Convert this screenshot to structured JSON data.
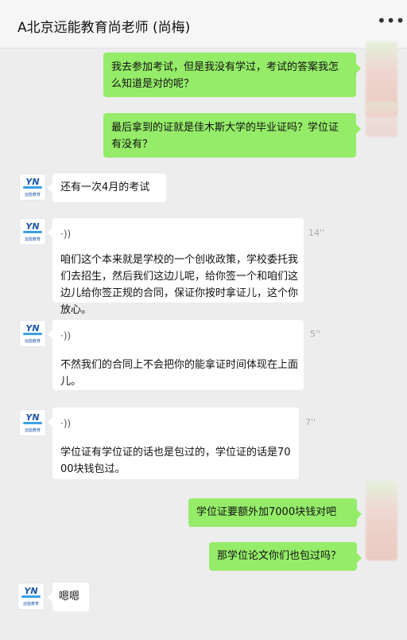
{
  "header": {
    "title": "A北京远能教育尚老师 (尚梅)",
    "more_icon": "more-dots-icon"
  },
  "avatar_other": {
    "logo_text": "YN",
    "logo_sub": "远能教育"
  },
  "messages": [
    {
      "from": "me",
      "text": "我去参加考试，但是我没有学过，考试的答案我怎么知道是对的呢？"
    },
    {
      "from": "me",
      "text": "最后拿到的证就是佳木斯大学的毕业证吗？学位证有没有？"
    },
    {
      "from": "other",
      "text": "还有一次4月的考试"
    },
    {
      "from": "other",
      "type": "voice",
      "duration": "14''",
      "voice_icon": "voice-wave-icon",
      "transcript": "咱们这个本来就是学校的一个创收政策，学校委托我们去招生，然后我们这边儿呢，给你签一个和咱们这边儿给你签正规的合同，保证你按时拿证儿，这个你放心。"
    },
    {
      "from": "other",
      "type": "voice",
      "duration": "5''",
      "voice_icon": "voice-wave-icon",
      "transcript": "不然我们的合同上不会把你的能拿证时间体现在上面儿。"
    },
    {
      "from": "other",
      "type": "voice",
      "duration": "7''",
      "voice_icon": "voice-wave-icon",
      "transcript": "学位证有学位证的话也是包过的，学位证的话是7000块钱包过。"
    },
    {
      "from": "me",
      "text": "学位证要额外加7000块钱对吧"
    },
    {
      "from": "me",
      "text": "那学位论文你们也包过吗？"
    },
    {
      "from": "other",
      "text": "嗯嗯"
    }
  ]
}
